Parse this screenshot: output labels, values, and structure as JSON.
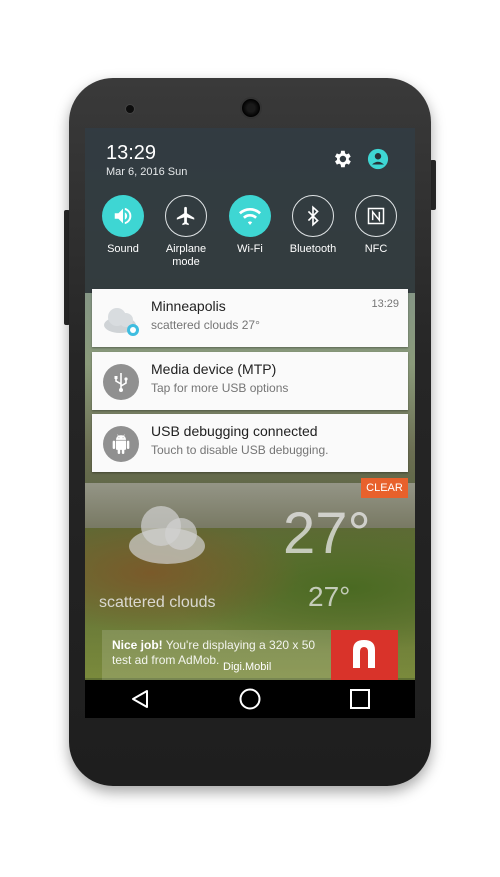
{
  "status": {
    "time": "13:29",
    "date": "Mar 6, 2016 Sun"
  },
  "quick_settings": [
    {
      "label": "Sound",
      "icon": "volume-icon",
      "active": true
    },
    {
      "label": "Airplane mode",
      "icon": "airplane-icon",
      "active": false
    },
    {
      "label": "Wi-Fi",
      "icon": "wifi-icon",
      "active": true
    },
    {
      "label": "Bluetooth",
      "icon": "bluetooth-icon",
      "active": false
    },
    {
      "label": "NFC",
      "icon": "nfc-icon",
      "active": false
    }
  ],
  "notifications": [
    {
      "title": "Minneapolis",
      "subtitle": "scattered clouds   27°",
      "time": "13:29",
      "icon": "cloud-icon"
    },
    {
      "title": "Media device (MTP)",
      "subtitle": "Tap for more USB options",
      "icon": "usb-icon"
    },
    {
      "title": "USB debugging connected",
      "subtitle": "Touch to disable USB debugging.",
      "icon": "android-icon"
    }
  ],
  "clear_label": "CLEAR",
  "widget": {
    "temp_big": "27°",
    "temp_small": "27°",
    "condition": "scattered clouds"
  },
  "ad": {
    "bold": "Nice job!",
    "text": " You're displaying a 320 x 50 test ad from AdMob.",
    "brand": "Digi.Mobil"
  },
  "colors": {
    "accent": "#3ed6d3",
    "clear": "#e8612c"
  }
}
